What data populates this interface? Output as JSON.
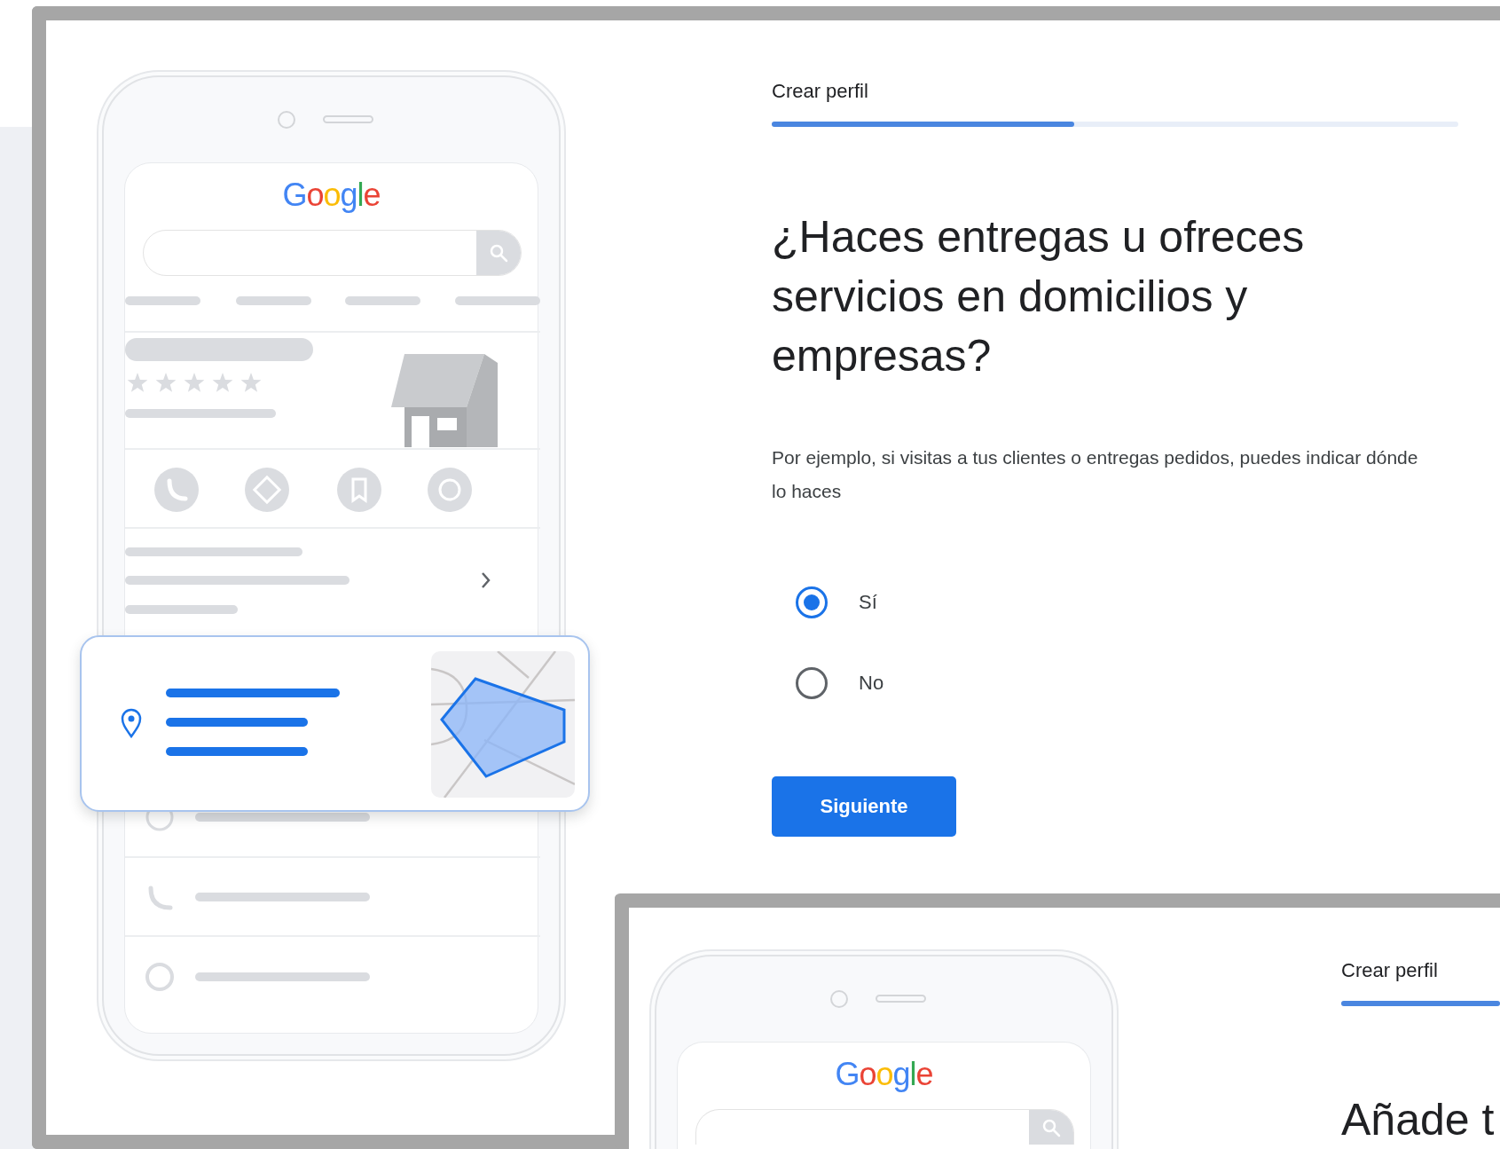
{
  "screens": [
    {
      "phone": {
        "kind": "full",
        "logo": "Google"
      },
      "step_label": "Crear perfil",
      "progress": {
        "level": 0.44
      },
      "question": "¿Haces entregas u ofreces servicios en domicilios y empresas?",
      "description": "Por ejemplo, si visitas a tus clientes o entregas pedidos, puedes indicar dónde lo haces",
      "options": [
        {
          "label": "Sí",
          "selected": true
        },
        {
          "label": "No",
          "selected": false
        }
      ],
      "next_button": "Siguiente"
    },
    {
      "phone": {
        "kind": "top",
        "logo": "Google"
      },
      "step_label": "Crear perfil",
      "progress": {
        "level": 1
      },
      "question": "Añade t"
    }
  ]
}
